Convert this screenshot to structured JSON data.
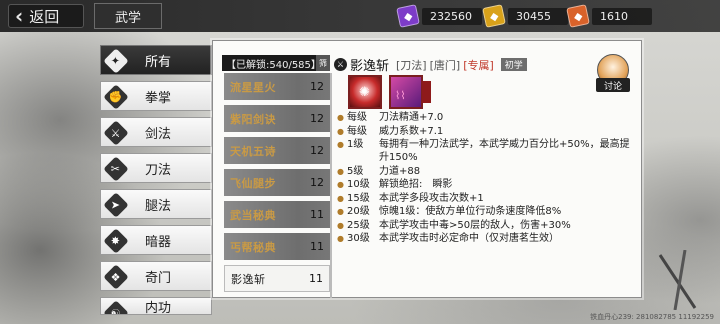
{
  "header": {
    "back_label": "返回",
    "title": "武学"
  },
  "currencies": [
    {
      "icon": "purple-gem-icon",
      "color": "#7d3cc8",
      "value": "232560"
    },
    {
      "icon": "gold-token-icon",
      "color": "#d9a21a",
      "value": "30455"
    },
    {
      "icon": "orange-token-icon",
      "color": "#d9622a",
      "value": "1610"
    }
  ],
  "categories": [
    {
      "label": "所有",
      "icon": "all-icon",
      "active": true
    },
    {
      "label": "拳掌",
      "icon": "fist-icon"
    },
    {
      "label": "剑法",
      "icon": "sword-icon"
    },
    {
      "label": "刀法",
      "icon": "blade-icon"
    },
    {
      "label": "腿法",
      "icon": "kick-icon"
    },
    {
      "label": "暗器",
      "icon": "dart-icon"
    },
    {
      "label": "奇门",
      "icon": "arcane-icon"
    },
    {
      "label": "内功",
      "icon": "internal-icon"
    }
  ],
  "unlocked": {
    "text": "【已解锁:540/585】",
    "end_label": "筛"
  },
  "skills": [
    {
      "name": "流星星火",
      "level": "12"
    },
    {
      "name": "紫阳剑诀",
      "level": "12"
    },
    {
      "name": "天机五诗",
      "level": "12"
    },
    {
      "name": "飞仙腿步",
      "level": "12"
    },
    {
      "name": "武当秘典",
      "level": "11"
    },
    {
      "name": "丐帮秘典",
      "level": "11"
    },
    {
      "name": "影逸斩",
      "level": "11",
      "active": true
    }
  ],
  "detail": {
    "name": "影逸斩",
    "type_tag": "[刀法]",
    "school_tag": "[唐门]",
    "exclusive_tag": "[专属]",
    "stage_badge": "初学",
    "effects": [
      {
        "level": "每级",
        "text": "刀法精通+7.0"
      },
      {
        "level": "每级",
        "text": "威力系数+7.1"
      },
      {
        "level": "1级",
        "text": "每拥有一种刀法武学，本武学威力百分比+50%，最高提升150%"
      },
      {
        "level": "5级",
        "text": "力道+88"
      },
      {
        "level": "10级",
        "text": "解锁绝招:　瞬影"
      },
      {
        "level": "15级",
        "text": "本武学多段攻击次数+1"
      },
      {
        "level": "20级",
        "text": "惊魄1级：使敌方单位行动条速度降低8%"
      },
      {
        "level": "25级",
        "text": "本武学攻击中毒>50层的敌人，伤害+30%"
      },
      {
        "level": "30级",
        "text": "本武学攻击时必定命中（仅对唐茗生效）"
      }
    ]
  },
  "avatar_label": "讨论",
  "player_info": "铁血丹心239: 281082785  11192259"
}
